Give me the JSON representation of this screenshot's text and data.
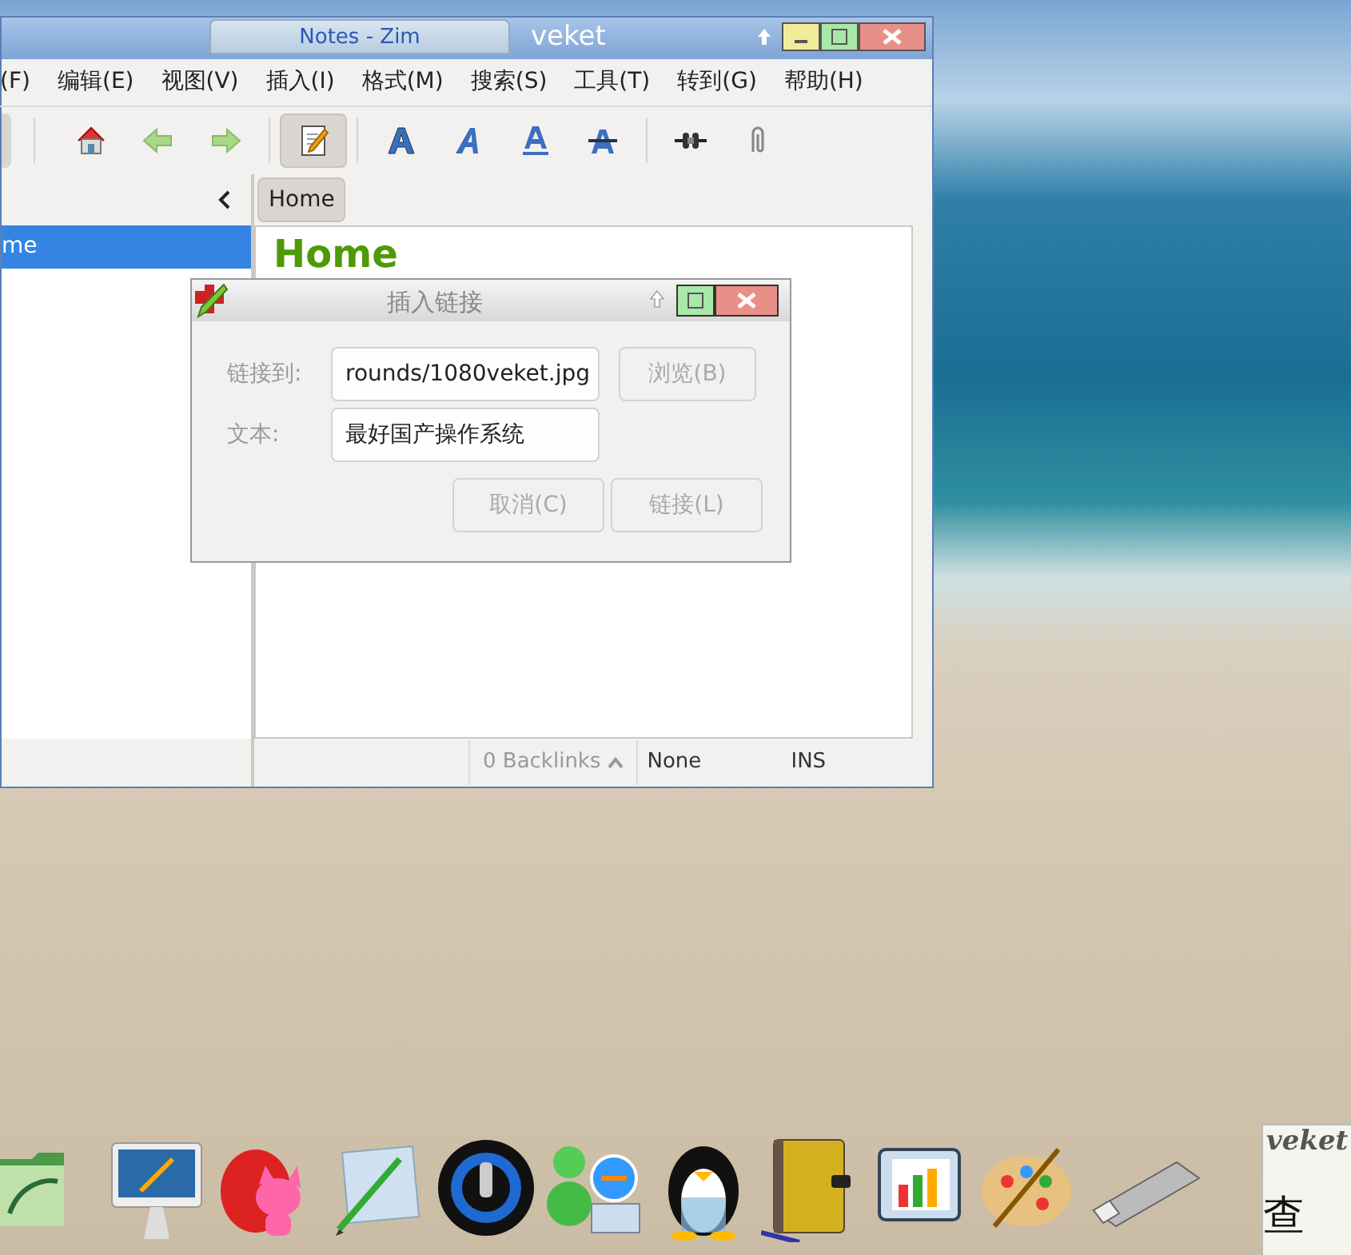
{
  "window": {
    "title": "Notes - Zim",
    "host_label": "veket"
  },
  "menu": [
    "(F)",
    "编辑(E)",
    "视图(V)",
    "插入(I)",
    "格式(M)",
    "搜索(S)",
    "工具(T)",
    "转到(G)",
    "帮助(H)"
  ],
  "toolbar": [
    {
      "kind": "home",
      "pressed": false
    },
    {
      "kind": "back",
      "pressed": false
    },
    {
      "kind": "forward",
      "pressed": false
    },
    {
      "kind": "edit",
      "pressed": true
    },
    {
      "kind": "bold",
      "pressed": false
    },
    {
      "kind": "italic",
      "pressed": false
    },
    {
      "kind": "underline",
      "pressed": false
    },
    {
      "kind": "strike",
      "pressed": false
    },
    {
      "kind": "link",
      "pressed": false
    },
    {
      "kind": "attach",
      "pressed": false
    }
  ],
  "pathbar": [
    {
      "label": "Home",
      "selected": true
    }
  ],
  "sidebar": {
    "items": [
      {
        "label": "me",
        "selected": true
      }
    ]
  },
  "page": {
    "heading": "Home"
  },
  "status_bar": {
    "backlinks": "0 Backlinks",
    "style": "None",
    "mode": "INS"
  },
  "dialog": {
    "title": "插入链接",
    "fields": [
      {
        "label": "链接到:",
        "value": "rounds/1080veket.jpg"
      },
      {
        "label": "文本:",
        "value": "最好国产操作系统"
      }
    ],
    "browse": "浏览(B)",
    "buttons": [
      "取消(C)",
      "链接(L)"
    ]
  },
  "dock": [
    {
      "kind": "folder"
    },
    {
      "kind": "monitor"
    },
    {
      "kind": "cat"
    },
    {
      "kind": "notepad"
    },
    {
      "kind": "speaker"
    },
    {
      "kind": "users"
    },
    {
      "kind": "penguin"
    },
    {
      "kind": "book"
    },
    {
      "kind": "chart"
    },
    {
      "kind": "palette"
    },
    {
      "kind": "usb"
    }
  ],
  "corner_widget": {
    "label": "veket",
    "caption": "查"
  }
}
